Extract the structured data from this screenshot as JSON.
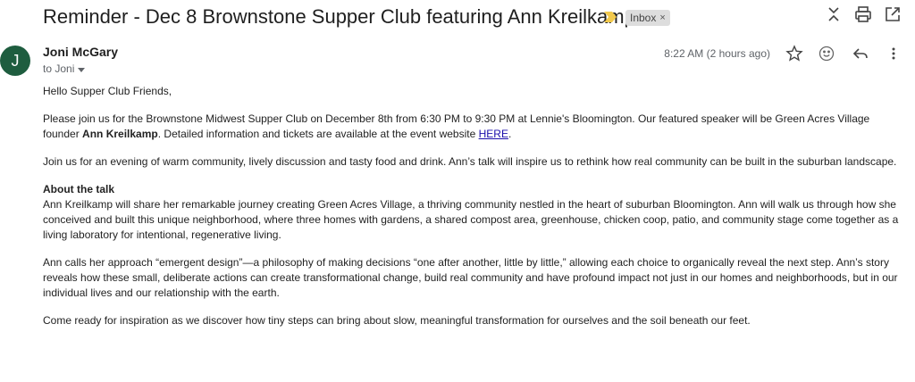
{
  "subject": "Reminder - Dec 8 Brownstone Supper Club featuring Ann Kreilkamp",
  "label_chip": {
    "text": "Inbox",
    "close": "×"
  },
  "icons": {
    "importance": "importance-marker-icon",
    "collapse": "collapse-all-icon",
    "print": "print-icon",
    "open_new_window": "open-in-new-window-icon",
    "star": "star-icon",
    "emoji": "emoji-reaction-icon",
    "reply": "reply-icon",
    "more": "more-options-icon"
  },
  "colors": {
    "avatar": "#1e5d3f",
    "importance": "#f2c94c",
    "link": "#1a0dab"
  },
  "message": {
    "avatar_letter": "J",
    "sender": "Joni McGary",
    "recipient": "to Joni",
    "timestamp": "8:22 AM (2 hours ago)"
  },
  "body": {
    "greeting": "Hello Supper Club Friends,",
    "p1_a": "Please join us for the Brownstone Midwest Supper Club on December 8th from 6:30 PM to 9:30 PM at Lennie's Bloomington. Our featured speaker will be Green Acres Village founder ",
    "p1_name": "Ann Kreilkamp",
    "p1_b": ". Detailed information and tickets are available at the event website ",
    "p1_link": "HERE",
    "p1_c": ".",
    "p2": "Join us for an evening of warm community, lively discussion and tasty food and drink. Ann’s talk will inspire us to rethink how real community can be built in the suburban landscape.",
    "about_heading": "About the talk",
    "p3": "Ann Kreilkamp will share her remarkable journey creating Green Acres Village, a thriving community nestled in the heart of suburban Bloomington. Ann will walk us through how she conceived and built this unique neighborhood, where three homes with gardens, a shared compost area, greenhouse, chicken coop, patio, and community stage come together as a living laboratory for intentional, regenerative living.",
    "p4": "Ann calls her approach “emergent design”—a philosophy of making decisions “one after another, little by little,” allowing each choice to organically reveal the next step. Ann’s story reveals how these small, deliberate actions can create transformational change, build real community and have profound impact not just in our homes and neighborhoods, but in our individual lives and our relationship with the earth.",
    "p5": "Come ready for inspiration as we discover how tiny steps can bring about slow, meaningful transformation for ourselves and the soil beneath our feet."
  }
}
